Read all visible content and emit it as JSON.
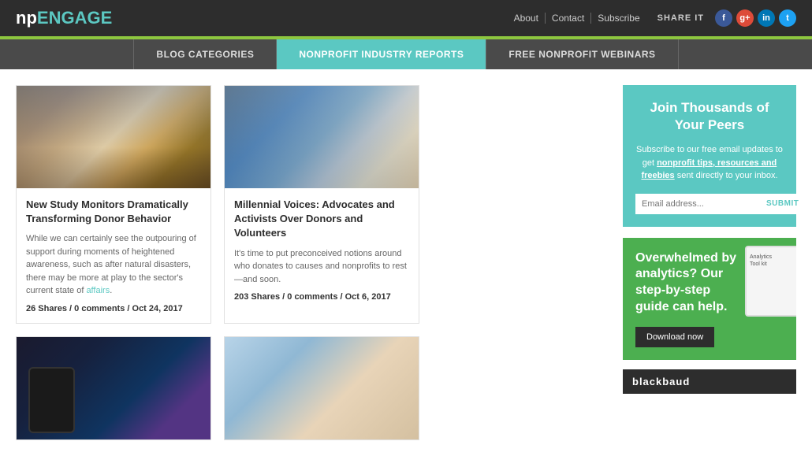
{
  "header": {
    "logo_np": "np",
    "logo_engage": "ENGAGE",
    "links": [
      "About",
      "Contact",
      "Subscribe"
    ],
    "share_it": "SHARE IT",
    "social": [
      {
        "name": "facebook",
        "symbol": "f"
      },
      {
        "name": "google-plus",
        "symbol": "g+"
      },
      {
        "name": "linkedin",
        "symbol": "in"
      },
      {
        "name": "twitter",
        "symbol": "t"
      }
    ]
  },
  "nav": {
    "items": [
      {
        "label": "BLOG CATEGORIES",
        "active": false
      },
      {
        "label": "NONPROFIT INDUSTRY REPORTS",
        "active": true
      },
      {
        "label": "FREE NONPROFIT WEBINARS",
        "active": false
      }
    ]
  },
  "articles": [
    {
      "id": "article-1",
      "title": "New Study Monitors Dramatically Transforming Donor Behavior",
      "excerpt": "While we can certainly see the outpouring of support during moments of heightened awareness, such as after natural disasters, there may be more at play to the sector's current state of affairs.",
      "excerpt_link": "affairs",
      "meta": "26 Shares / 0 comments / Oct 24, 2017",
      "image_type": "city"
    },
    {
      "id": "article-2",
      "title": "Millennial Voices: Advocates and Activists Over Donors and Volunteers",
      "excerpt": "It's time to put preconceived notions around who donates to causes and nonprofits to rest—and soon.",
      "meta": "203 Shares / 0 comments / Oct 6, 2017",
      "image_type": "phones"
    },
    {
      "id": "article-3",
      "title": "",
      "image_type": "mobile"
    },
    {
      "id": "article-4",
      "title": "",
      "image_type": "office"
    }
  ],
  "sidebar": {
    "join_title": "Join Thousands of Your Peers",
    "join_desc_1": "Subscribe to our free email updates to get ",
    "join_desc_highlight": "nonprofit tips, resources and freebies",
    "join_desc_2": " sent directly to your inbox.",
    "email_placeholder": "Email address...",
    "submit_label": "SUBMIT",
    "analytics_title": "Overwhelmed by analytics? Our step-by-step guide can help.",
    "download_label": "Download now",
    "blackbaud_label": "blackbaud"
  }
}
